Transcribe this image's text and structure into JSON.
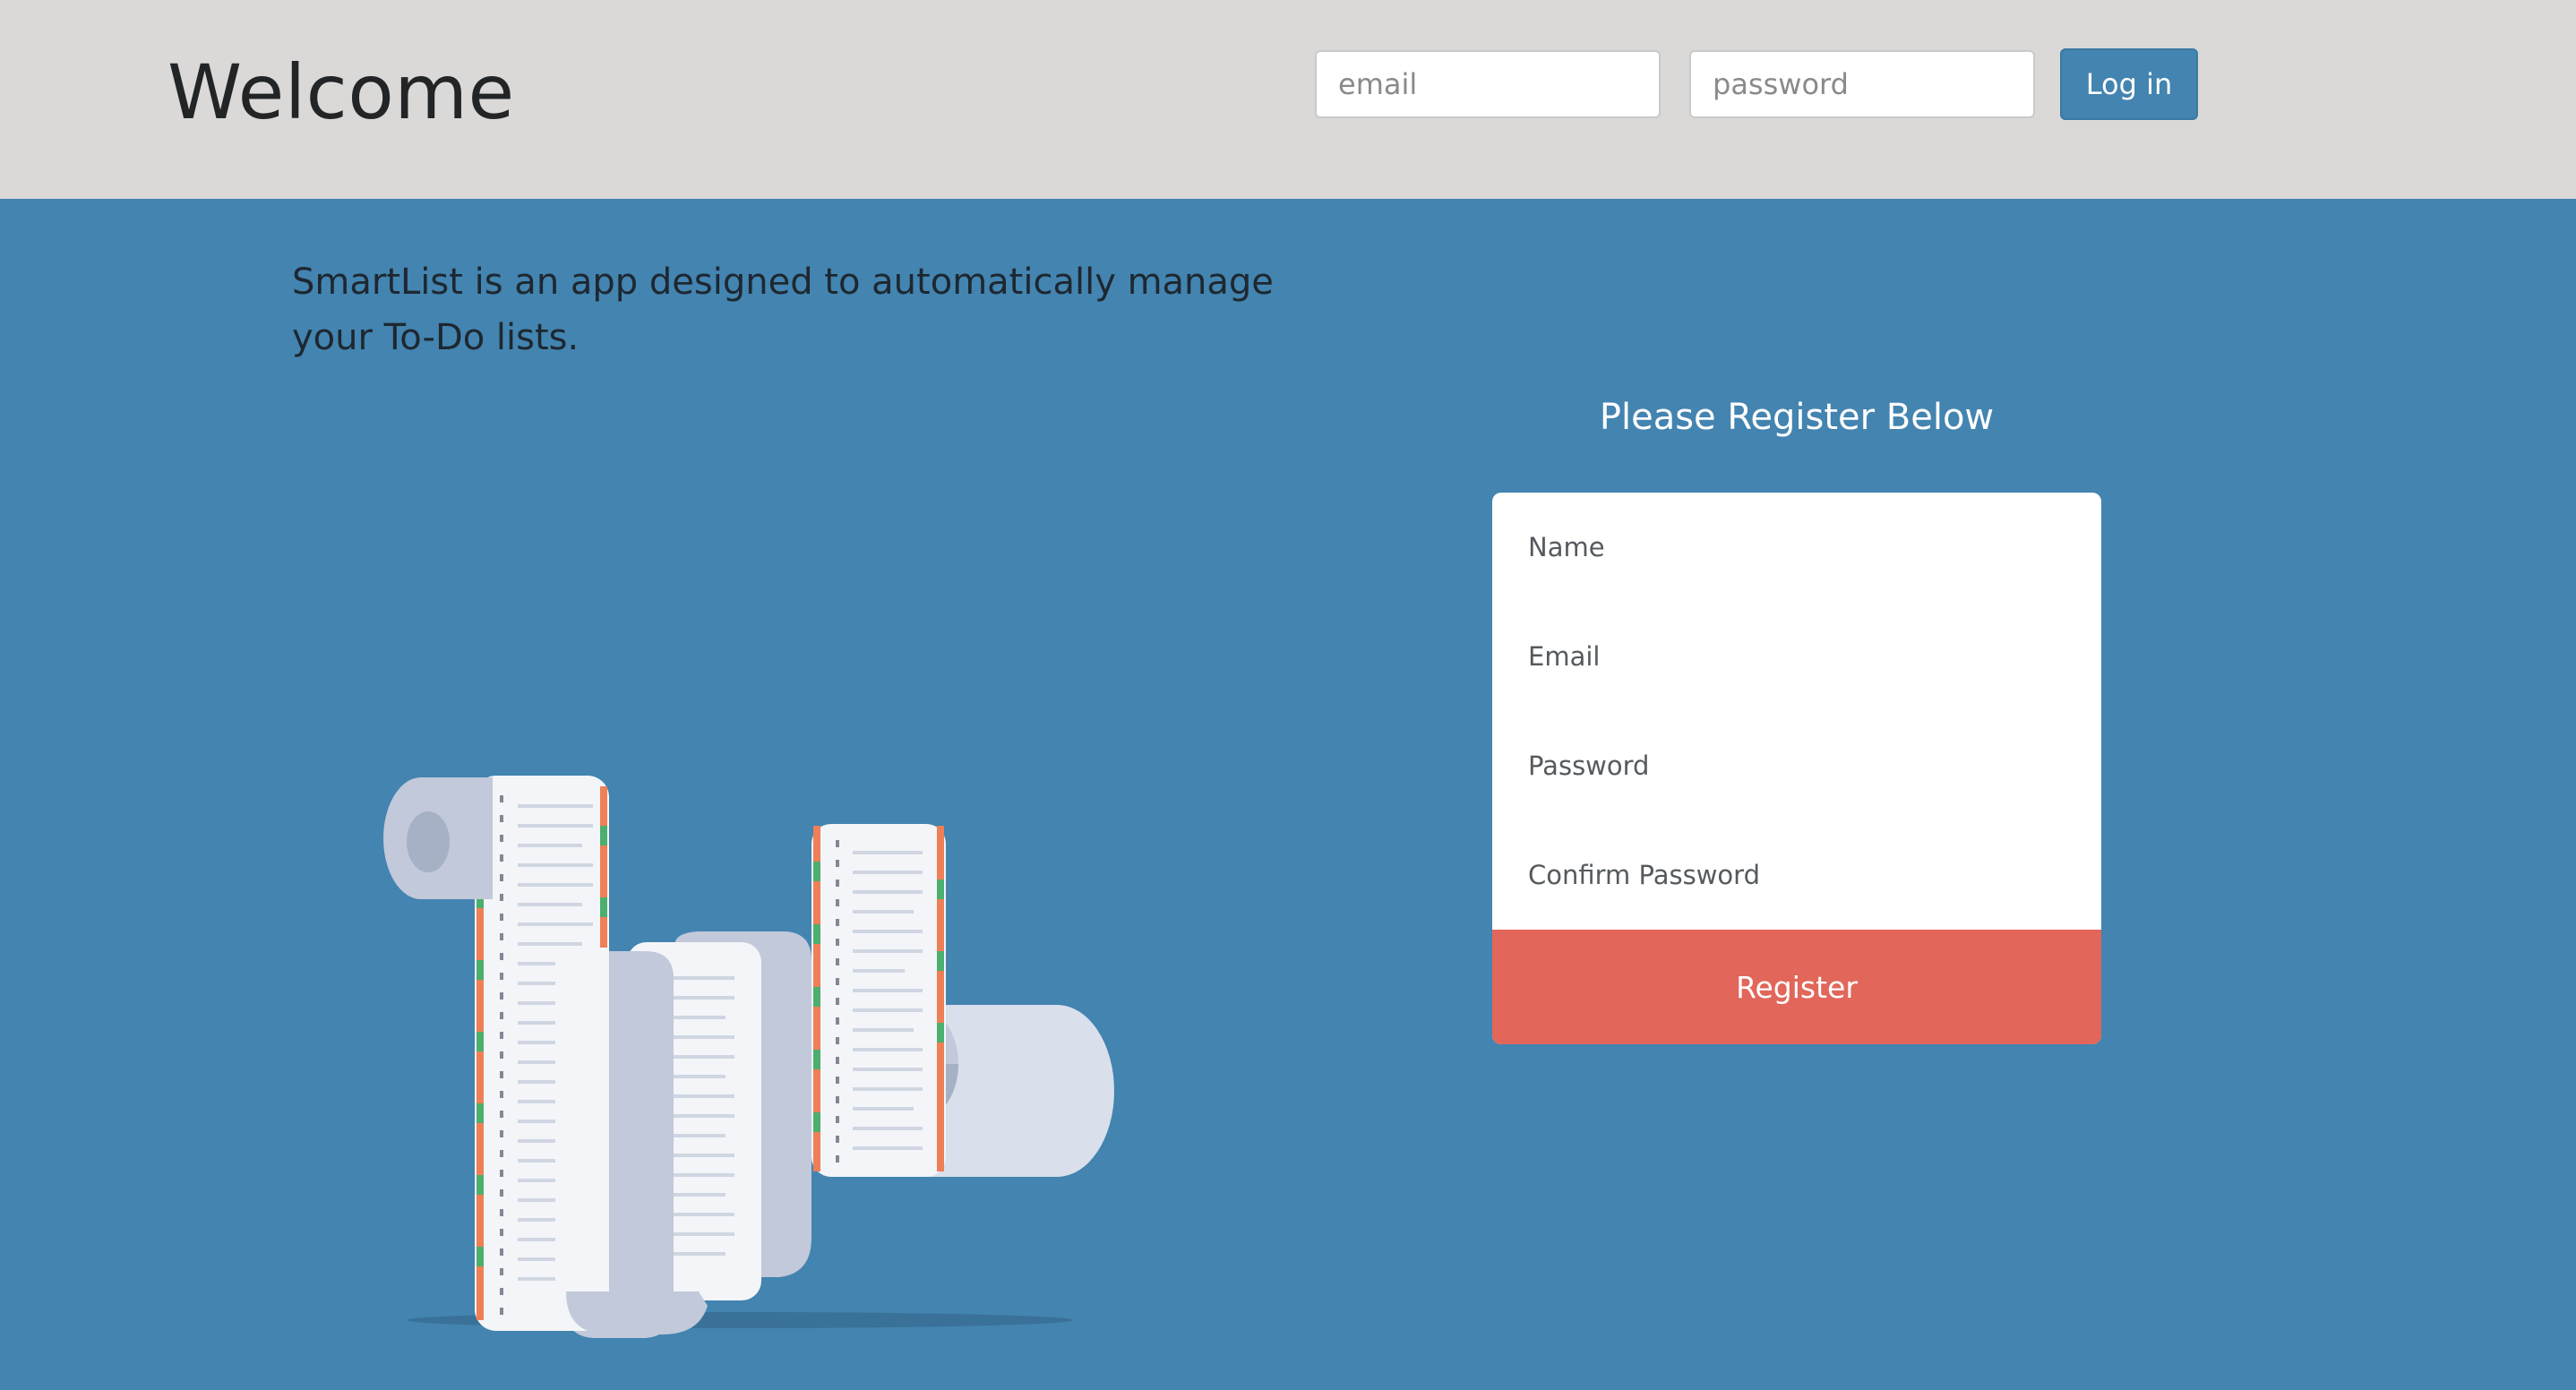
{
  "header": {
    "title": "Welcome",
    "email_placeholder": "email",
    "password_placeholder": "password",
    "login_label": "Log in"
  },
  "main": {
    "tagline": "SmartList is an app designed to automatically manage your To-Do lists."
  },
  "register": {
    "title": "Please Register Below",
    "name_placeholder": "Name",
    "email_placeholder": "Email",
    "password_placeholder": "Password",
    "confirm_placeholder": "Confirm Password",
    "button_label": "Register"
  },
  "colors": {
    "header_bg": "#dad9d8",
    "main_bg": "#4384b0",
    "login_button": "#4384b0",
    "register_button": "#e2665a",
    "stripe_green": "#4caf6e",
    "stripe_orange": "#ee7f56"
  },
  "icons": {
    "illustration": "receipt-scroll-illustration"
  }
}
